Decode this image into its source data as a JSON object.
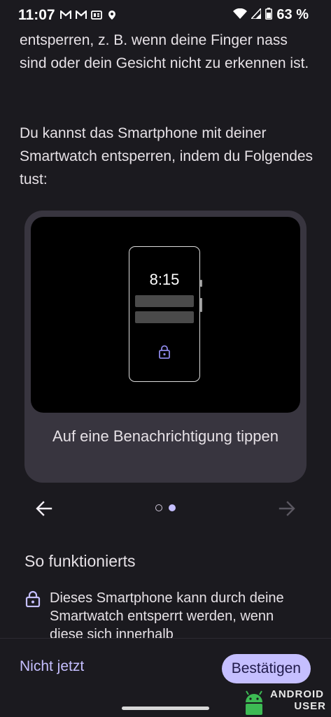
{
  "status_bar": {
    "time": "11:07",
    "left_icons": [
      "gmail-icon",
      "gmail-icon",
      "news-icon",
      "location-icon"
    ],
    "right_icons": [
      "wifi-icon",
      "signal-icon",
      "battery-icon"
    ],
    "battery": "63 %"
  },
  "content": {
    "intro_continuation": "entsperren, z. B. wenn deine Finger nass sind oder dein Gesicht nicht zu erkennen ist.",
    "intro_paragraph": "Du kannst das Smartphone mit deiner Smartwatch entsperren, indem du Folgendes tust:"
  },
  "illustration": {
    "phone_time": "8:15",
    "caption": "Auf eine Benachrichtigung tippen",
    "page_count": 2,
    "current_page": 2
  },
  "how_it_works": {
    "title": "So funktionierts",
    "item_text": "Dieses Smartphone kann durch deine Smartwatch entsperrt werden, wenn diese sich innerhalb"
  },
  "actions": {
    "secondary": "Nicht jetzt",
    "primary": "Bestätigen"
  },
  "watermark": {
    "line1": "ANDROID",
    "line2": "USER"
  },
  "colors": {
    "background": "#1b1a1f",
    "card": "#38353f",
    "accent": "#c5bfff"
  }
}
